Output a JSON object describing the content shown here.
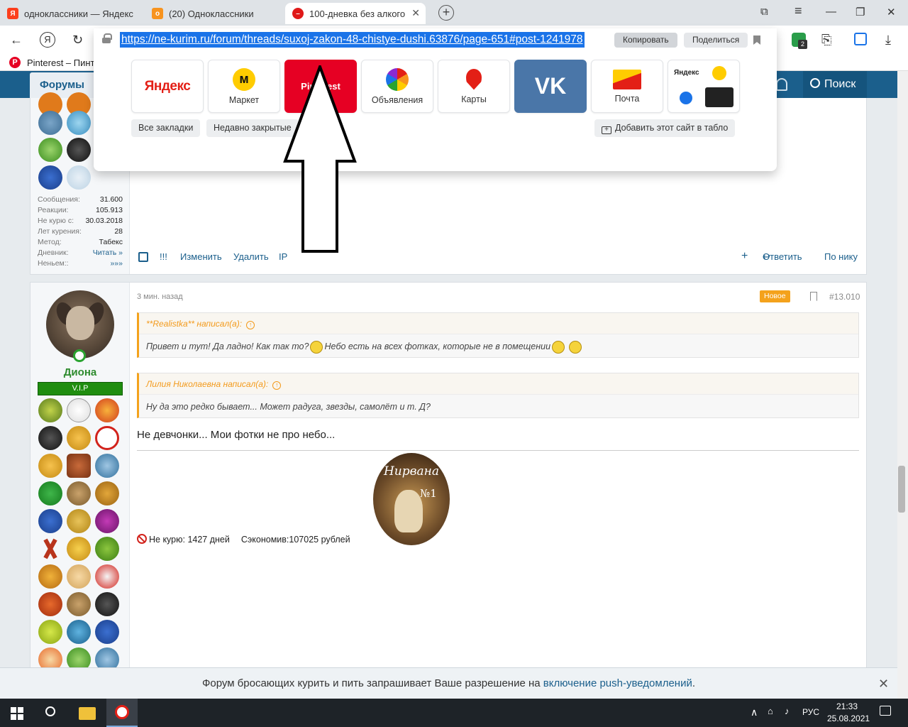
{
  "tabs": [
    {
      "title": "одноклассники — Яндекс",
      "favicon": "Я",
      "color": "#fc3f1d"
    },
    {
      "title": "(20) Одноклассники",
      "favicon": "ok",
      "color": "#f7931e"
    },
    {
      "title": "100-дневка без алкого",
      "favicon": "no-sign",
      "color": "#e01919"
    }
  ],
  "url": "https://ne-kurim.ru/forum/threads/suxoj-zakon-48-chistye-dushi.63876/page-651#post-1241978",
  "url_buttons": {
    "copy": "Копировать",
    "share": "Поделиться"
  },
  "tiles": [
    {
      "label": "Яндекс",
      "logo": "Яндекс"
    },
    {
      "label": "Маркет"
    },
    {
      "label": "Pinterest"
    },
    {
      "label": "Объявления"
    },
    {
      "label": "Карты"
    },
    {
      "label": ""
    },
    {
      "label": "Почта"
    },
    {
      "label": ""
    }
  ],
  "tile_mini_yandex": "Яндекс",
  "chips": {
    "all_bookmarks": "Все закладки",
    "recent_closed": "Недавно закрытые",
    "add_site": "Добавить этот сайт в табло"
  },
  "bookmarks": {
    "pinterest": "Pinterest – Пинт"
  },
  "site": {
    "forums_tab": "Форумы",
    "search": "Поиск"
  },
  "post1": {
    "stats": [
      {
        "k": "Сообщения:",
        "v": "31.600"
      },
      {
        "k": "Реакции:",
        "v": "105.913"
      },
      {
        "k": "Не курю с:",
        "v": "30.03.2018"
      },
      {
        "k": "Лет курения:",
        "v": "28"
      },
      {
        "k": "Метод:",
        "v": "Табекс"
      },
      {
        "k": "Дневник:",
        "v": "Читать »"
      },
      {
        "k": "Неньем::",
        "v": "»»»"
      }
    ],
    "actions": {
      "mark": "!!!",
      "edit": "Изменить",
      "delete": "Удалить",
      "ip": "IP",
      "plus": "+",
      "reply": "Ответить",
      "by_nick": "По нику"
    }
  },
  "post2": {
    "username": "Диона",
    "rank": "V.I.P",
    "time": "3 мин. назад",
    "badge": "Новое",
    "number": "#13.010",
    "quote1": {
      "author": "**Realistka** написал(а):",
      "text_a": "Привет и тут! Да ладно! Как так то?",
      "text_b": "Небо есть на всех фотках, которые не в помещении"
    },
    "quote2": {
      "author": "Лилия Николаевна написал(а):",
      "text": "Ну да это редко бывает... Может радуга, звезды, самолёт и т. Д?"
    },
    "text": "Не девчонки... Мои фотки не про небо...",
    "signature": {
      "label1": "Не курю: ",
      "days": "1427 дней",
      "label2": "Сэкономив:",
      "saved": "107025 рублей"
    },
    "nirvana": {
      "title": "Нирвана",
      "num": "№1"
    }
  },
  "push": {
    "text": "Форум бросающих курить и пить запрашивает Ваше разрешение на ",
    "link": "включение push-уведомлений",
    "end": "."
  },
  "taskbar": {
    "lang": "РУС",
    "time": "21:33",
    "date": "25.08.2021",
    "ext_badge": "2"
  }
}
